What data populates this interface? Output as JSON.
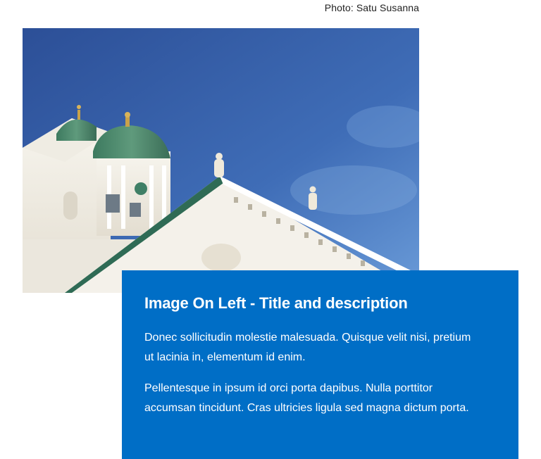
{
  "photo_credit": "Photo: Satu Susanna",
  "image": {
    "alt": "Helsinki Cathedral against blue sky"
  },
  "card": {
    "title": "Image On Left - Title and description",
    "paragraphs": [
      "Donec sollicitudin molestie malesuada. Quisque velit nisi, pretium ut lacinia in, elementum id enim.",
      "Pellentesque in ipsum id orci porta dapibus. Nulla porttitor accumsan tincidunt. Cras ultricies ligula sed magna dictum porta."
    ]
  },
  "colors": {
    "card_background": "#006ec6",
    "sky_top": "#2f58a0",
    "sky_bottom": "#5b8fd2",
    "dome": "#4a8a6e",
    "building": "#f2efe6"
  }
}
